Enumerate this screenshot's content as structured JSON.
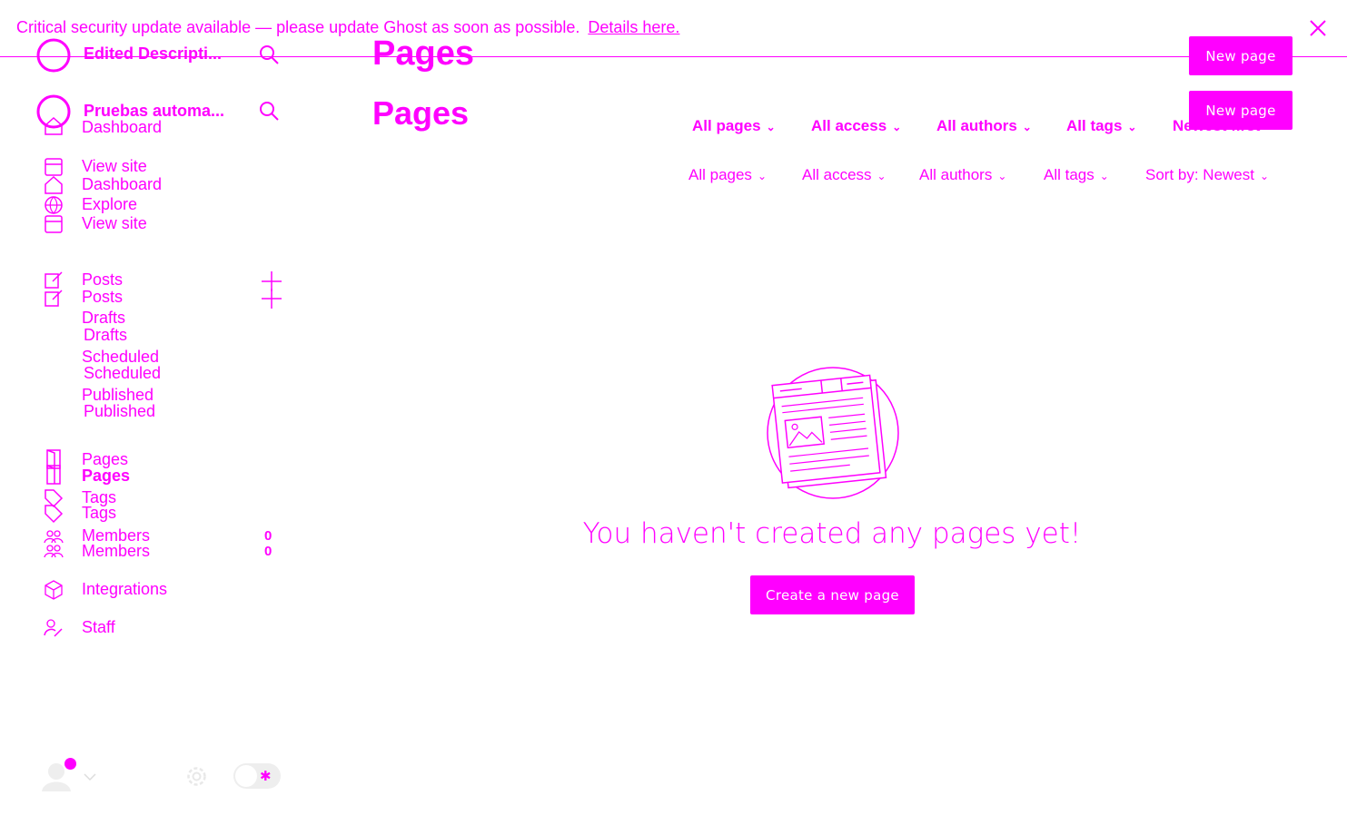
{
  "banner": {
    "message": "Critical security update available — please update Ghost as soon as possible.",
    "link": "Details here.",
    "close_icon": "close-icon"
  },
  "sidebar": {
    "site_title_top": "Edited Descripti...",
    "site_title": "Pruebas automa...",
    "nav_top": [
      {
        "label": "Dashboard",
        "icon": "home-icon"
      },
      {
        "label": "View site",
        "icon": "browser-icon"
      },
      {
        "label": "Dashboard",
        "icon": "home-icon"
      },
      {
        "label": "Explore",
        "icon": "globe-icon"
      },
      {
        "label": "View site",
        "icon": "browser-icon"
      }
    ],
    "posts": {
      "label_a": "Posts",
      "label_b": "Posts",
      "sub": [
        "Drafts",
        "Drafts",
        "Scheduled",
        "Scheduled",
        "Published",
        "Published"
      ]
    },
    "nav_bottom": {
      "pages_a": "Pages",
      "pages_b": "Pages",
      "tags_a": "Tags",
      "tags_b": "Tags",
      "members_a": "Members",
      "members_b": "Members",
      "members_count_a": "0",
      "members_count_b": "0",
      "integrations": "Integrations",
      "staff": "Staff"
    }
  },
  "main": {
    "title_a": "Pages",
    "title_b": "Pages",
    "new_page_a": "New page",
    "new_page_b": "New page",
    "filters_a": [
      "All pages",
      "All access",
      "All authors",
      "All tags",
      "Newest first"
    ],
    "filters_b": [
      "All pages",
      "All access",
      "All authors",
      "All tags",
      "Sort by: Newest"
    ],
    "empty_message": "You haven't created any pages yet!",
    "create_button": "Create a new page"
  },
  "colors": {
    "accent": "#ff00ff",
    "background": "#ffffff"
  }
}
